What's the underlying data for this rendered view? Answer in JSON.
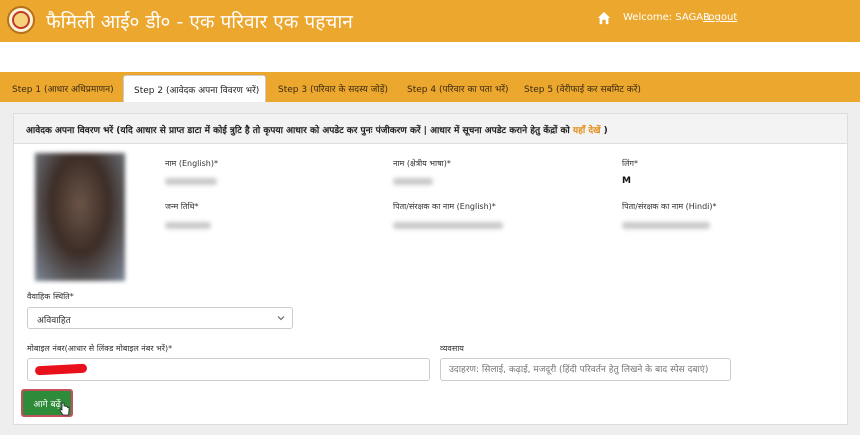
{
  "header": {
    "title": "फैमिली आई० डी० - एक परिवार एक पहचान",
    "welcome": "Welcome: SAGAR",
    "logout": "Logout"
  },
  "tabs": [
    {
      "label": "Step 1 (आधार अधिप्रमाणन)"
    },
    {
      "label": "Step 2 (आवेदक अपना विवरण भरें)"
    },
    {
      "label": "Step 3 (परिवार के सदस्य जोड़ें)"
    },
    {
      "label": "Step 4 (परिवार का पता भरें)"
    },
    {
      "label": "Step 5 (वेरीफाई कर सबमिट करें)"
    }
  ],
  "panel": {
    "heading": "आवेदक अपना विवरण भरें (यदि आधार से प्राप्त डाटा में कोई त्रुटि है तो कृपया आधार को अपडेट कर पुनः पंजीकरण करें | आधार में सूचना अपडेट कराने हेतु केंद्रों को",
    "heading_link": "यहाँ देखें",
    "heading_end": ")"
  },
  "fields": {
    "name_en_label": "नाम (English)*",
    "name_regional_label": "नाम (क्षेत्रीय भाषा)*",
    "gender_label": "लिंग*",
    "gender_value": "M",
    "dob_label": "जन्म तिथि*",
    "guardian_en_label": "पिता/संरक्षक का नाम (English)*",
    "guardian_hi_label": "पिता/संरक्षक का नाम (Hindi)*",
    "marital_label": "वैवाहिक स्थिति*",
    "marital_value": "अविवाहित",
    "mobile_label": "मोबाइल नंबर(आधार से लिंक्ड मोबाइल नंबर भरें)*",
    "occupation_label": "व्यवसाय",
    "occupation_placeholder": "उदाहरण: सिलाई, कढ़ाई, मजदूरी (हिंदी परिवर्तन हेतु लिखने के बाद स्पेस दबाएं)"
  },
  "buttons": {
    "next": "आगे बढ़ें"
  },
  "icons": {
    "home": "home-icon",
    "chevron": "chevron-down-icon",
    "cursor": "hand-pointer-icon"
  },
  "colors": {
    "header": "#eca72e",
    "next_button": "#2e8b3a",
    "link": "#e58e1a"
  }
}
